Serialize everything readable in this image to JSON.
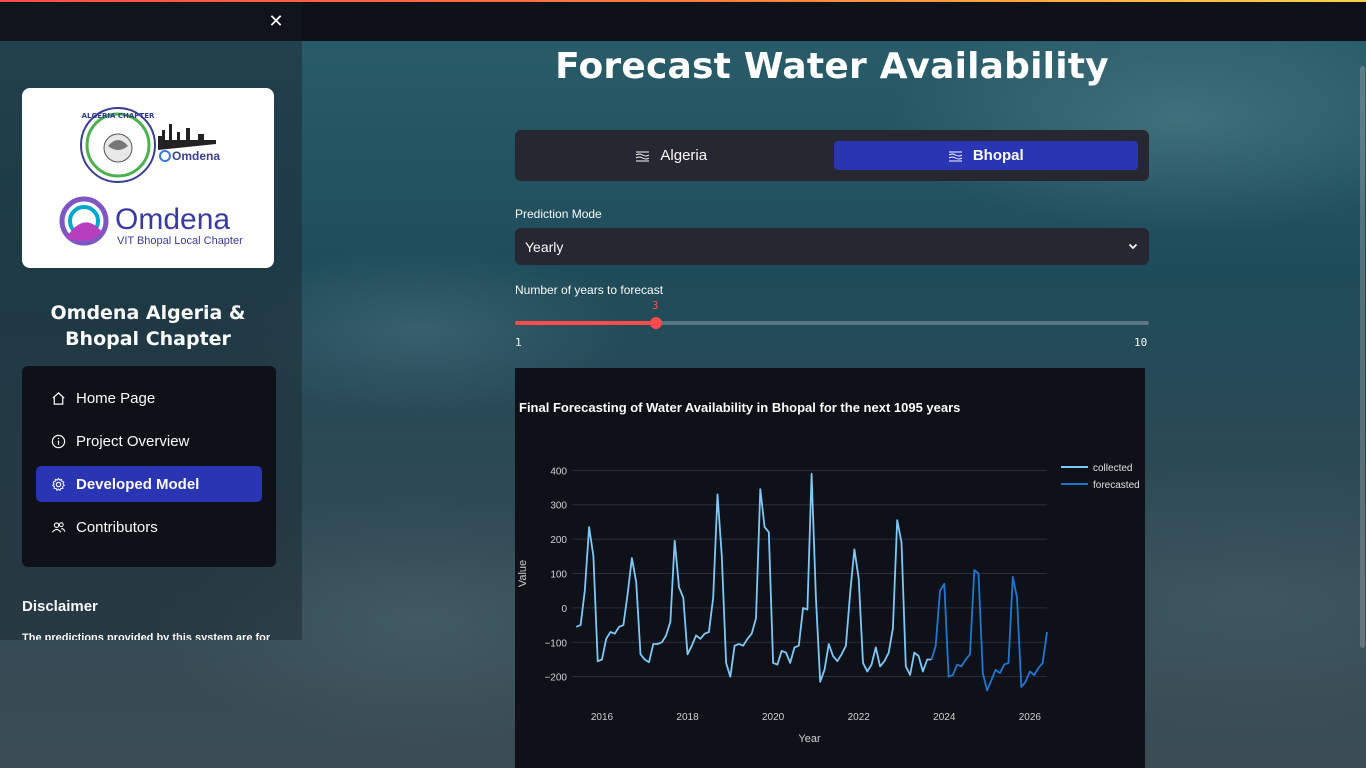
{
  "sidebar": {
    "close_icon": "close-icon",
    "logo": {
      "algeria_text": "ALGERIA CHAPTER",
      "omdena_small": "Omdena",
      "omdena_big": "Omdena",
      "omdena_sub": "VIT Bhopal Local Chapter"
    },
    "title": "Omdena Algeria & Bhopal Chapter",
    "nav": {
      "items": [
        {
          "label": "Home Page",
          "icon": "house-icon"
        },
        {
          "label": "Project Overview",
          "icon": "info-icon"
        },
        {
          "label": "Developed Model",
          "icon": "gear-icon"
        },
        {
          "label": "Contributors",
          "icon": "people-icon"
        }
      ],
      "active_index": 2
    },
    "disclaimer_title": "Disclaimer",
    "disclaimer_text": "The predictions provided by this system are for"
  },
  "main": {
    "title": "Forecast Water Availability",
    "tabs": [
      {
        "label": "Algeria",
        "icon": "water-icon"
      },
      {
        "label": "Bhopal",
        "icon": "water-icon"
      }
    ],
    "active_tab": 1,
    "prediction_mode": {
      "label": "Prediction Mode",
      "value": "Yearly"
    },
    "years_slider": {
      "label": "Number of years to forecast",
      "value": "3",
      "min": "1",
      "max": "10",
      "fraction": 0.2222
    }
  },
  "colors": {
    "accent": "#2a35b3",
    "slider": "#ff4b4b",
    "collected": "#7ec8f8",
    "forecasted": "#1f77d4",
    "panel": "#0e1117"
  },
  "chart_data": {
    "type": "line",
    "title": "Final Forecasting of Water Availability in Bhopal for the next 1095 years",
    "xlabel": "Year",
    "ylabel": "Value",
    "xlim": [
      2015.3,
      2026.4
    ],
    "ylim": [
      -230,
      430
    ],
    "xticks": [
      "2016",
      "2018",
      "2020",
      "2022",
      "2024",
      "2026"
    ],
    "yticks": [
      "400",
      "300",
      "200",
      "100",
      "0",
      "−100",
      "−200"
    ],
    "legend_position": "top-right",
    "series": [
      {
        "name": "collected",
        "x": [
          2015.4,
          2015.5,
          2015.6,
          2015.7,
          2015.8,
          2015.9,
          2016.0,
          2016.1,
          2016.2,
          2016.3,
          2016.4,
          2016.5,
          2016.6,
          2016.7,
          2016.8,
          2016.9,
          2017.0,
          2017.1,
          2017.2,
          2017.3,
          2017.4,
          2017.5,
          2017.6,
          2017.7,
          2017.8,
          2017.9,
          2018.0,
          2018.1,
          2018.2,
          2018.3,
          2018.4,
          2018.5,
          2018.6,
          2018.7,
          2018.8,
          2018.9,
          2019.0,
          2019.1,
          2019.2,
          2019.3,
          2019.4,
          2019.5,
          2019.6,
          2019.7,
          2019.8,
          2019.9,
          2020.0,
          2020.1,
          2020.2,
          2020.3,
          2020.4,
          2020.5,
          2020.6,
          2020.7,
          2020.8,
          2020.9,
          2021.0,
          2021.1,
          2021.2,
          2021.3,
          2021.4,
          2021.5,
          2021.6,
          2021.7,
          2021.8,
          2021.9,
          2022.0,
          2022.1,
          2022.2,
          2022.3,
          2022.4,
          2022.5,
          2022.6,
          2022.7,
          2022.8,
          2022.9,
          2023.0,
          2023.1,
          2023.2,
          2023.3,
          2023.4,
          2023.5,
          2023.6,
          2023.7
        ],
        "values": [
          -55,
          -50,
          50,
          235,
          150,
          -155,
          -150,
          -90,
          -70,
          -75,
          -55,
          -50,
          40,
          145,
          75,
          -135,
          -150,
          -158,
          -105,
          -105,
          -100,
          -80,
          -40,
          195,
          60,
          30,
          -135,
          -110,
          -80,
          -90,
          -75,
          -70,
          30,
          330,
          150,
          -160,
          -200,
          -110,
          -105,
          -110,
          -90,
          -75,
          -30,
          345,
          235,
          220,
          -160,
          -165,
          -125,
          -130,
          -160,
          -115,
          -110,
          0,
          -5,
          390,
          30,
          -215,
          -180,
          -105,
          -140,
          -155,
          -135,
          -110,
          45,
          170,
          85,
          -160,
          -185,
          -165,
          -115,
          -170,
          -155,
          -130,
          -60,
          255,
          190,
          -170,
          -195,
          -130,
          -140,
          -185,
          -150,
          -150
        ]
      },
      {
        "name": "forecasted",
        "x": [
          2023.7,
          2023.8,
          2023.9,
          2024.0,
          2024.1,
          2024.2,
          2024.3,
          2024.4,
          2024.5,
          2024.6,
          2024.7,
          2024.8,
          2024.9,
          2025.0,
          2025.1,
          2025.2,
          2025.3,
          2025.4,
          2025.5,
          2025.6,
          2025.7,
          2025.8,
          2025.9,
          2026.0,
          2026.1,
          2026.2,
          2026.3,
          2026.4
        ],
        "values": [
          -150,
          -110,
          50,
          70,
          -200,
          -195,
          -165,
          -170,
          -150,
          -135,
          110,
          100,
          -190,
          -240,
          -210,
          -180,
          -190,
          -165,
          -160,
          90,
          30,
          -230,
          -215,
          -185,
          -195,
          -175,
          -160,
          -70
        ]
      }
    ]
  }
}
